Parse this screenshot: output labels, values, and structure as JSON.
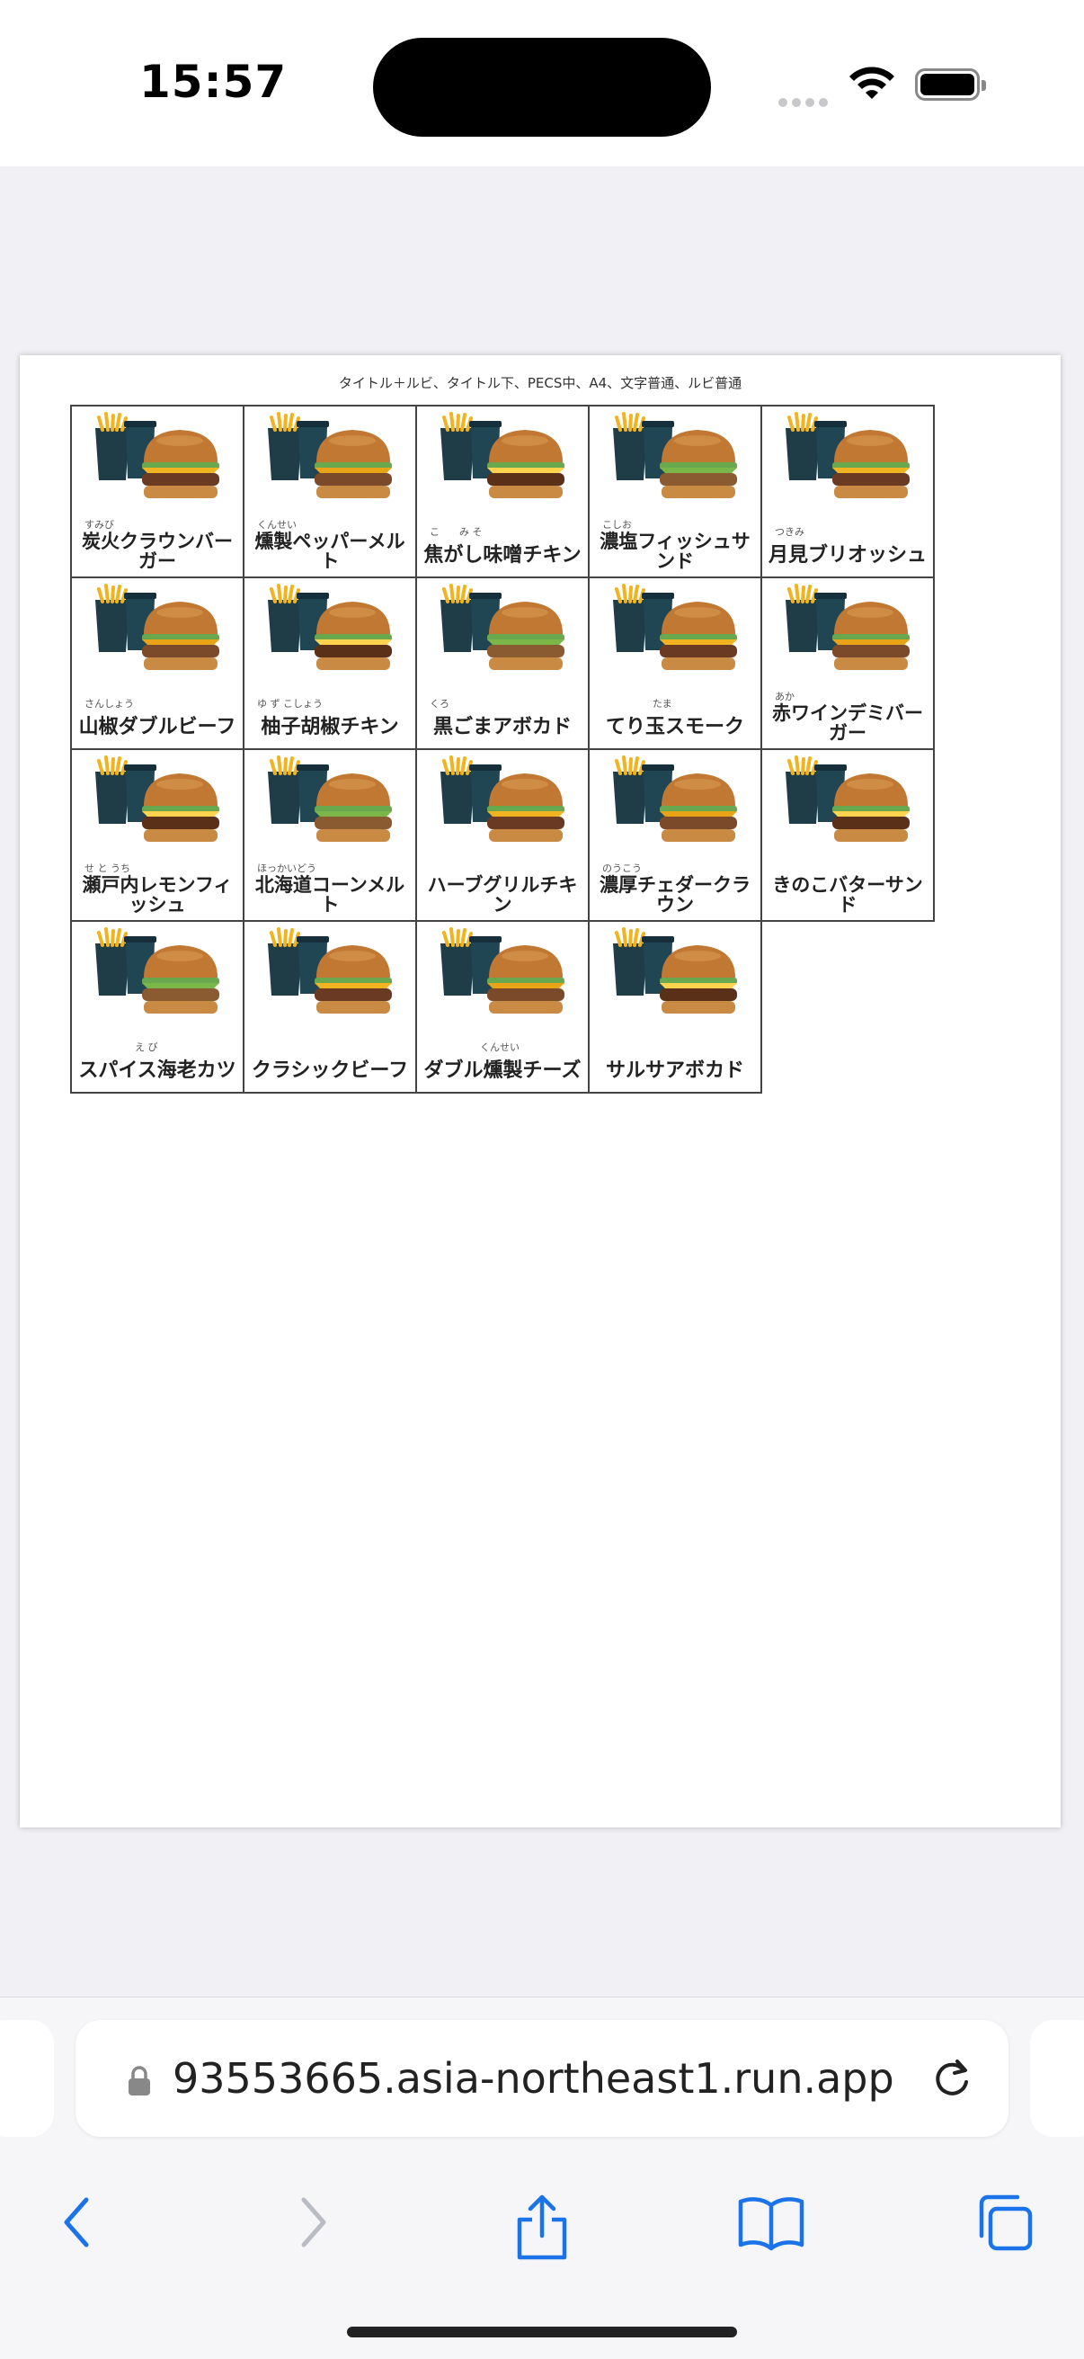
{
  "status": {
    "time": "15:57"
  },
  "paper": {
    "caption": "タイトル＋ルビ、タイトル下、PECS中、A4、文字普通、ルビ普通",
    "items": [
      {
        "label": "炭火クラウンバーガー",
        "ruby": "すみび",
        "ruby_pos": "left"
      },
      {
        "label": "燻製ペッパーメルト",
        "ruby": "くんせい",
        "ruby_pos": "left"
      },
      {
        "label": "焦がし味噌チキン",
        "ruby": "こ　　み そ",
        "ruby_pos": "left"
      },
      {
        "label": "濃塩フィッシュサンド",
        "ruby": "こしお",
        "ruby_pos": "left"
      },
      {
        "label": "月見ブリオッシュ",
        "ruby": "つきみ",
        "ruby_pos": "left"
      },
      {
        "label": "山椒ダブルビーフ",
        "ruby": "さんしょう",
        "ruby_pos": "left"
      },
      {
        "label": "柚子胡椒チキン",
        "ruby": "ゆ ず こしょう",
        "ruby_pos": "left"
      },
      {
        "label": "黒ごまアボカド",
        "ruby": "くろ",
        "ruby_pos": "left"
      },
      {
        "label": "てり玉スモーク",
        "ruby": "たま",
        "ruby_pos": "mid"
      },
      {
        "label": "赤ワインデミバーガー",
        "ruby": "あか",
        "ruby_pos": "left"
      },
      {
        "label": "瀬戸内レモンフィッシュ",
        "ruby": "せ と うち",
        "ruby_pos": "left"
      },
      {
        "label": "北海道コーンメルト",
        "ruby": "ほっかいどう",
        "ruby_pos": "left"
      },
      {
        "label": "ハーブグリルチキン",
        "ruby": "",
        "ruby_pos": "left"
      },
      {
        "label": "濃厚チェダークラウン",
        "ruby": "のうこう",
        "ruby_pos": "left"
      },
      {
        "label": "きのこバターサンド",
        "ruby": "",
        "ruby_pos": "left"
      },
      {
        "label": "スパイス海老カツ",
        "ruby": "え び",
        "ruby_pos": "mid"
      },
      {
        "label": "クラシックビーフ",
        "ruby": "",
        "ruby_pos": "left"
      },
      {
        "label": "ダブル燻製チーズ",
        "ruby": "くんせい",
        "ruby_pos": "mid"
      },
      {
        "label": "サルサアボカド",
        "ruby": "",
        "ruby_pos": "left"
      }
    ]
  },
  "browser": {
    "url": "93553665.asia-northeast1.run.app",
    "icons": [
      "lock-icon",
      "reload-icon",
      "back-icon",
      "forward-icon",
      "share-icon",
      "bookmarks-icon",
      "tabs-icon"
    ],
    "accent": "#1a73e8"
  }
}
